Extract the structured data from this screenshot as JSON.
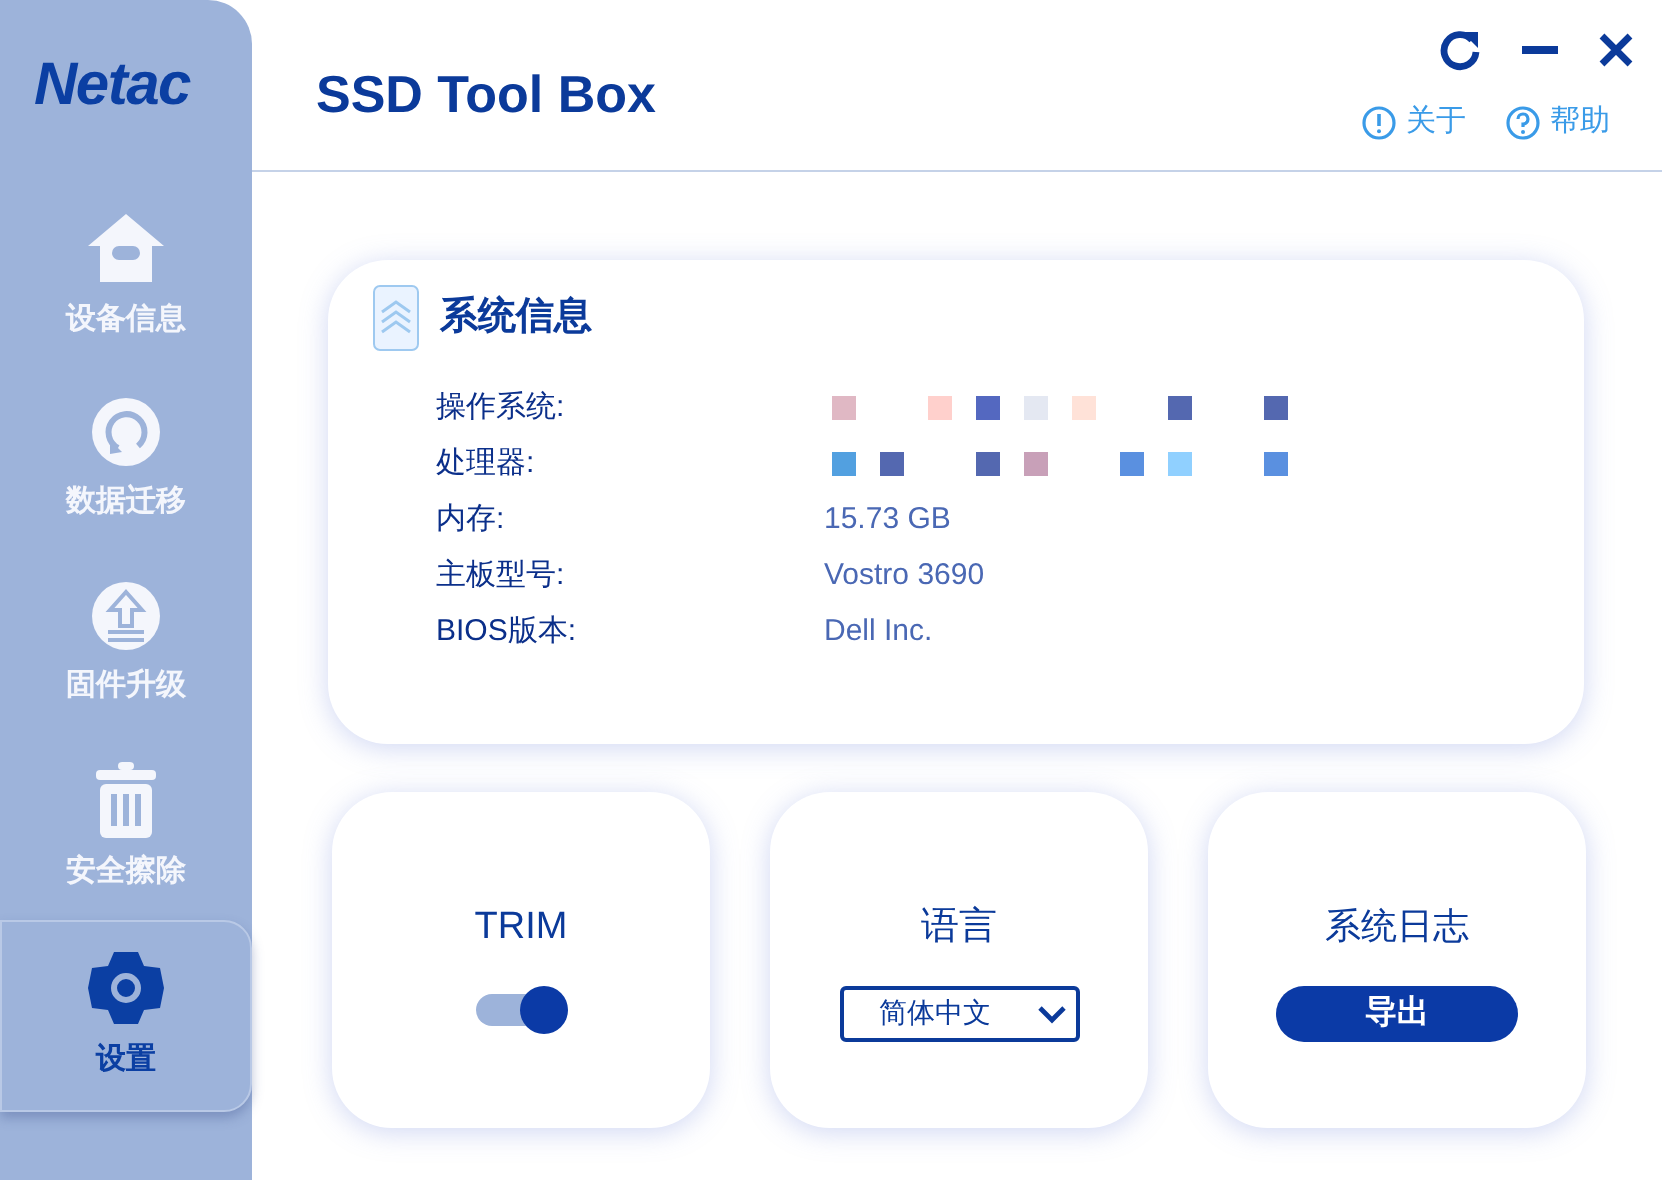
{
  "brand": {
    "logo": "Netac",
    "title": "SSD Tool Box"
  },
  "header_links": [
    {
      "label": "关于",
      "kind": "info"
    },
    {
      "label": "帮助",
      "kind": "help"
    }
  ],
  "sidebar": {
    "items": [
      {
        "label": "设备信息",
        "selected": false
      },
      {
        "label": "数据迁移",
        "selected": false
      },
      {
        "label": "固件升级",
        "selected": false
      },
      {
        "label": "安全擦除",
        "selected": false
      },
      {
        "label": "设置",
        "selected": true
      }
    ]
  },
  "system_info": {
    "title": "系统信息",
    "rows": [
      {
        "label": "操作系统:",
        "kind": "redacted"
      },
      {
        "label": "处理器:",
        "kind": "redacted"
      },
      {
        "label": "内存:",
        "kind": "text",
        "value": "15.73 GB"
      },
      {
        "label": "主板型号:",
        "kind": "text",
        "value": "Vostro 3690"
      },
      {
        "label": "BIOS版本:",
        "kind": "text",
        "value": "Dell Inc."
      }
    ]
  },
  "trim": {
    "label": "TRIM",
    "on": true
  },
  "language": {
    "label": "语言",
    "value": "简体中文"
  },
  "system_log": {
    "label": "系统日志",
    "button": "导出"
  }
}
